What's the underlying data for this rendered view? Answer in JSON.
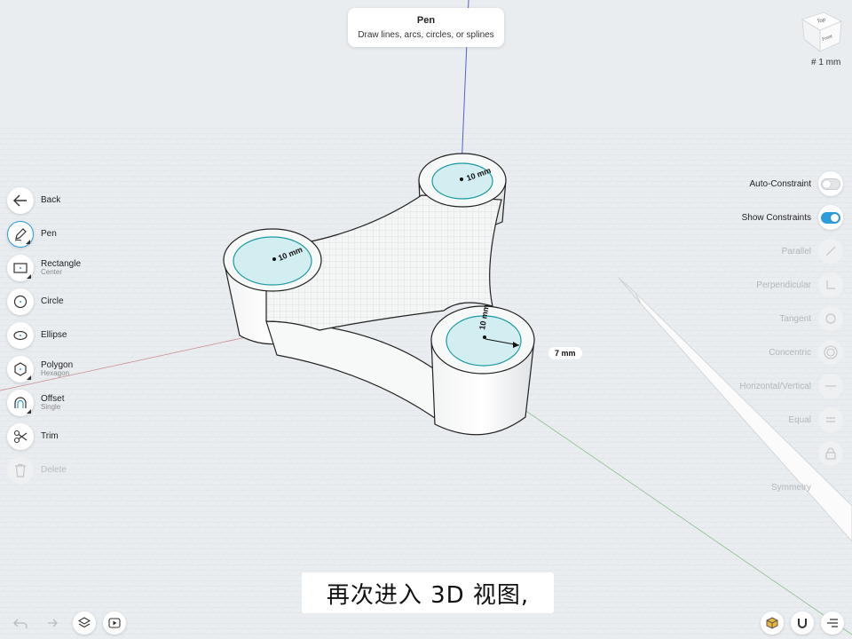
{
  "tooltip": {
    "title": "Pen",
    "description": "Draw lines, arcs, circles, or splines"
  },
  "view_cube": {
    "top_face": "Top",
    "front_face": "Front"
  },
  "grid_scale": "# 1 mm",
  "tools": [
    {
      "label": "Back",
      "sublabel": "",
      "icon": "back-arrow-icon",
      "active": false,
      "enabled": true
    },
    {
      "label": "Pen",
      "sublabel": "",
      "icon": "pen-icon",
      "active": true,
      "enabled": true
    },
    {
      "label": "Rectangle",
      "sublabel": "Center",
      "icon": "rectangle-icon",
      "active": false,
      "enabled": true
    },
    {
      "label": "Circle",
      "sublabel": "",
      "icon": "circle-icon",
      "active": false,
      "enabled": true
    },
    {
      "label": "Ellipse",
      "sublabel": "",
      "icon": "ellipse-icon",
      "active": false,
      "enabled": true
    },
    {
      "label": "Polygon",
      "sublabel": "Hexagon",
      "icon": "hexagon-icon",
      "active": false,
      "enabled": true
    },
    {
      "label": "Offset",
      "sublabel": "Single",
      "icon": "offset-icon",
      "active": false,
      "enabled": true
    },
    {
      "label": "Trim",
      "sublabel": "",
      "icon": "scissors-icon",
      "active": false,
      "enabled": true
    },
    {
      "label": "Delete",
      "sublabel": "",
      "icon": "trash-icon",
      "active": false,
      "enabled": false
    }
  ],
  "settings": {
    "auto_constraint": {
      "label": "Auto-Constraint",
      "on": false
    },
    "show_constraints": {
      "label": "Show Constraints",
      "on": true
    }
  },
  "constraints": [
    {
      "label": "Parallel",
      "icon": "parallel-icon"
    },
    {
      "label": "Perpendicular",
      "icon": "perpendicular-icon"
    },
    {
      "label": "Tangent",
      "icon": "tangent-icon"
    },
    {
      "label": "Concentric",
      "icon": "concentric-icon"
    },
    {
      "label": "Horizontal/Vertical",
      "icon": "horizontal-vertical-icon"
    },
    {
      "label": "Equal",
      "icon": "equal-icon"
    },
    {
      "label": "",
      "icon": "lock-icon"
    },
    {
      "label": "Symmetry",
      "icon": "symmetry-icon"
    }
  ],
  "dimensions": {
    "top_boss": "10 mm",
    "left_boss": "10 mm",
    "right_boss": "10 mm",
    "radius": "7 mm"
  },
  "subtitle": "再次进入 3D 视图,",
  "colors": {
    "accent": "#2d9cdb",
    "sketch_fill": "#d3eef0",
    "sketch_stroke": "#1a9aa0"
  }
}
